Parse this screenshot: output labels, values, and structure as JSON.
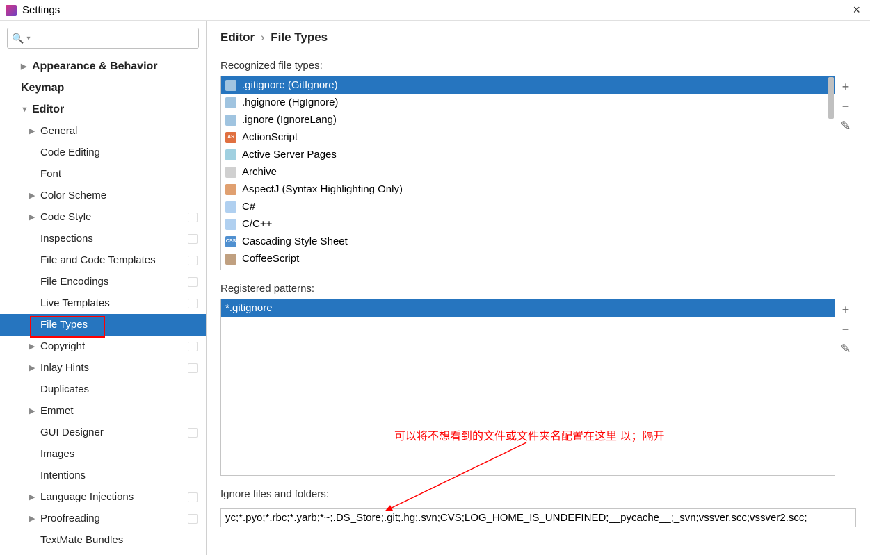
{
  "title": "Settings",
  "breadcrumb": {
    "parent": "Editor",
    "current": "File Types"
  },
  "sidebar": {
    "items": [
      {
        "label": "Appearance & Behavior",
        "level": 1,
        "arrow": "▶",
        "bold": true
      },
      {
        "label": "Keymap",
        "level": 1,
        "arrow": "",
        "bold": true
      },
      {
        "label": "Editor",
        "level": 1,
        "arrow": "▼",
        "bold": true
      },
      {
        "label": "General",
        "level": 2,
        "arrow": "▶"
      },
      {
        "label": "Code Editing",
        "level": 2,
        "arrow": ""
      },
      {
        "label": "Font",
        "level": 2,
        "arrow": ""
      },
      {
        "label": "Color Scheme",
        "level": 2,
        "arrow": "▶"
      },
      {
        "label": "Code Style",
        "level": 2,
        "arrow": "▶",
        "badge": true
      },
      {
        "label": "Inspections",
        "level": 2,
        "arrow": "",
        "badge": true
      },
      {
        "label": "File and Code Templates",
        "level": 2,
        "arrow": "",
        "badge": true
      },
      {
        "label": "File Encodings",
        "level": 2,
        "arrow": "",
        "badge": true
      },
      {
        "label": "Live Templates",
        "level": 2,
        "arrow": "",
        "badge": true
      },
      {
        "label": "File Types",
        "level": 2,
        "arrow": "",
        "selected": true
      },
      {
        "label": "Copyright",
        "level": 2,
        "arrow": "▶",
        "badge": true
      },
      {
        "label": "Inlay Hints",
        "level": 2,
        "arrow": "▶",
        "badge": true
      },
      {
        "label": "Duplicates",
        "level": 2,
        "arrow": ""
      },
      {
        "label": "Emmet",
        "level": 2,
        "arrow": "▶"
      },
      {
        "label": "GUI Designer",
        "level": 2,
        "arrow": "",
        "badge": true
      },
      {
        "label": "Images",
        "level": 2,
        "arrow": ""
      },
      {
        "label": "Intentions",
        "level": 2,
        "arrow": ""
      },
      {
        "label": "Language Injections",
        "level": 2,
        "arrow": "▶",
        "badge": true
      },
      {
        "label": "Proofreading",
        "level": 2,
        "arrow": "▶",
        "badge": true
      },
      {
        "label": "TextMate Bundles",
        "level": 2,
        "arrow": ""
      }
    ]
  },
  "labels": {
    "recognized": "Recognized file types:",
    "patterns": "Registered patterns:",
    "ignore": "Ignore files and folders:"
  },
  "filetypes": [
    {
      "label": ".gitignore (GitIgnore)",
      "icon": "ign",
      "selected": true
    },
    {
      "label": ".hgignore (HgIgnore)",
      "icon": "ign"
    },
    {
      "label": ".ignore (IgnoreLang)",
      "icon": "ign"
    },
    {
      "label": "ActionScript",
      "icon": "as"
    },
    {
      "label": "Active Server Pages",
      "icon": "asp"
    },
    {
      "label": "Archive",
      "icon": "arch"
    },
    {
      "label": "AspectJ (Syntax Highlighting Only)",
      "icon": "aj"
    },
    {
      "label": "C#",
      "icon": "cs"
    },
    {
      "label": "C/C++",
      "icon": "c"
    },
    {
      "label": "Cascading Style Sheet",
      "icon": "css"
    },
    {
      "label": "CoffeeScript",
      "icon": "coffee"
    }
  ],
  "patterns": [
    {
      "label": "*.gitignore",
      "selected": true
    }
  ],
  "ignore_value": "yc;*.pyo;*.rbc;*.yarb;*~;.DS_Store;.git;.hg;.svn;CVS;LOG_HOME_IS_UNDEFINED;__pycache__;_svn;vssver.scc;vssver2.scc;",
  "annotation": "可以将不想看到的文件或文件夹名配置在这里 以；隔开",
  "icon_text": {
    "as": "AS",
    "css": "CSS"
  }
}
